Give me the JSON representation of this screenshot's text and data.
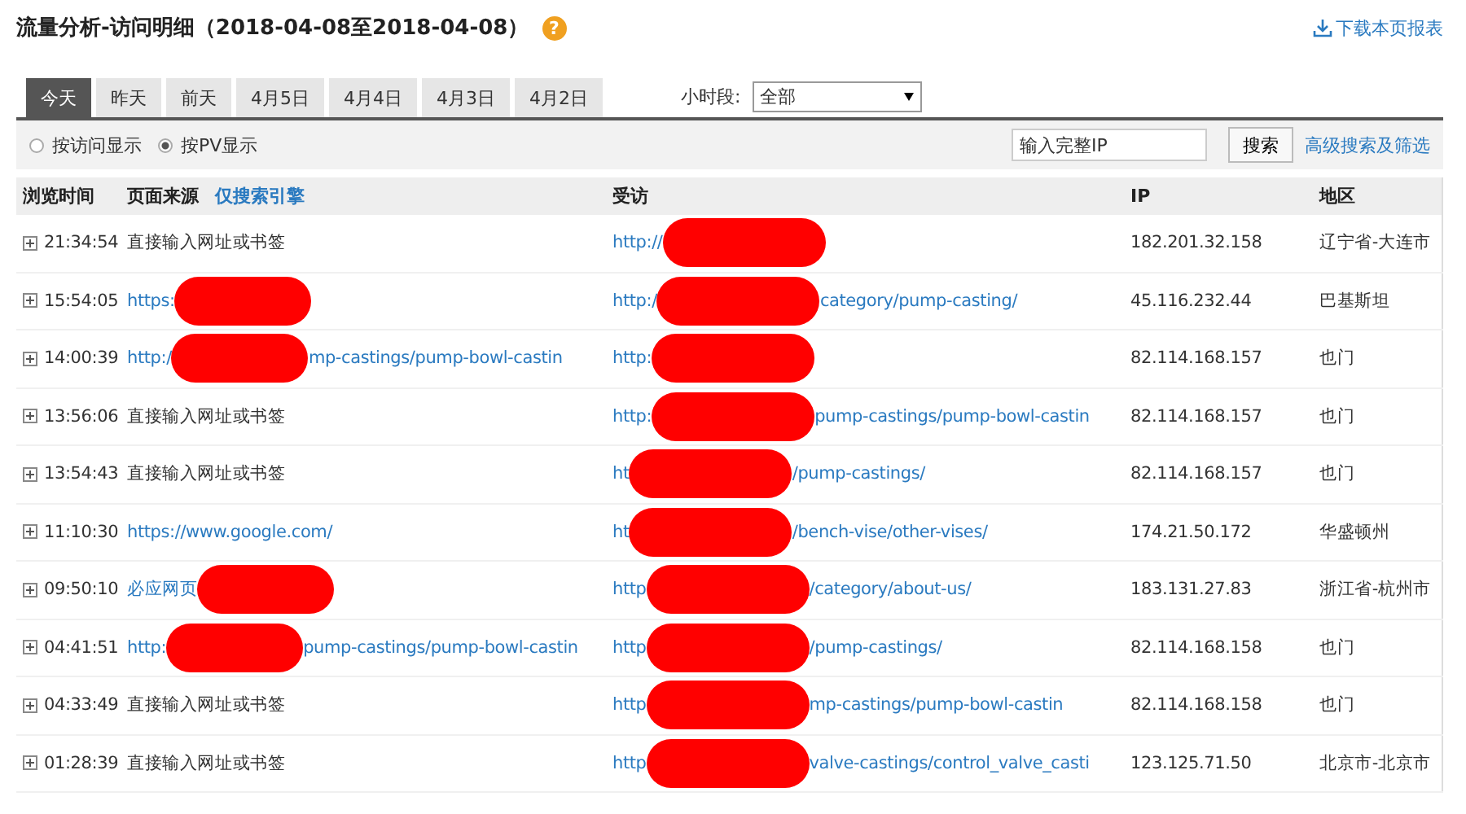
{
  "title": "流量分析-访问明细（2018-04-08至2018-04-08）",
  "help_icon": "?",
  "download_link": "下载本页报表",
  "tabs": [
    {
      "label": "今天",
      "selected": true
    },
    {
      "label": "昨天",
      "selected": false
    },
    {
      "label": "前天",
      "selected": false
    },
    {
      "label": "4月5日",
      "selected": false
    },
    {
      "label": "4月4日",
      "selected": false
    },
    {
      "label": "4月3日",
      "selected": false
    },
    {
      "label": "4月2日",
      "selected": false
    }
  ],
  "time_filter": {
    "label": "小时段:",
    "value": "全部"
  },
  "display_modes": [
    {
      "label": "按访问显示",
      "selected": false
    },
    {
      "label": "按PV显示",
      "selected": true
    }
  ],
  "ip_search": {
    "placeholder": "输入完整IP",
    "button": "搜索",
    "advanced_link": "高级搜索及筛选"
  },
  "table": {
    "columns": [
      "浏览时间",
      "页面来源",
      "受访",
      "IP",
      "地区"
    ],
    "source_filter_link": "仅搜索引擎",
    "rows": [
      {
        "time": "21:34:54",
        "source": {
          "kind": "text",
          "head": "直接输入网址或书签",
          "redacted": false
        },
        "visited": {
          "head": "http://",
          "redacted": true
        },
        "ip": "182.201.32.158",
        "region": "辽宁省-大连市"
      },
      {
        "time": "15:54:05",
        "source": {
          "kind": "link",
          "head": "https:",
          "redacted": true
        },
        "visited": {
          "head": "http:/",
          "redacted": true,
          "tail": "category/pump-casting/"
        },
        "ip": "45.116.232.44",
        "region": "巴基斯坦"
      },
      {
        "time": "14:00:39",
        "source": {
          "kind": "link",
          "head": "http:/",
          "redacted": true,
          "tail": "mp-castings/pump-bowl-castin"
        },
        "visited": {
          "head": "http:",
          "redacted": true
        },
        "ip": "82.114.168.157",
        "region": "也门"
      },
      {
        "time": "13:56:06",
        "source": {
          "kind": "text",
          "head": "直接输入网址或书签",
          "redacted": false
        },
        "visited": {
          "head": "http:",
          "redacted": true,
          "tail": "pump-castings/pump-bowl-castin"
        },
        "ip": "82.114.168.157",
        "region": "也门"
      },
      {
        "time": "13:54:43",
        "source": {
          "kind": "text",
          "head": "直接输入网址或书签",
          "redacted": false
        },
        "visited": {
          "head": "ht",
          "redacted": true,
          "tail": "/pump-castings/"
        },
        "ip": "82.114.168.157",
        "region": "也门"
      },
      {
        "time": "11:10:30",
        "source": {
          "kind": "link",
          "head": "https://www.google.com/",
          "redacted": false
        },
        "visited": {
          "head": "ht",
          "redacted": true,
          "tail": "/bench-vise/other-vises/"
        },
        "ip": "174.21.50.172",
        "region": "华盛顿州"
      },
      {
        "time": "09:50:10",
        "source": {
          "kind": "link",
          "head": "必应网页",
          "redacted": true
        },
        "visited": {
          "head": "http",
          "redacted": true,
          "tail": "/category/about-us/"
        },
        "ip": "183.131.27.83",
        "region": "浙江省-杭州市"
      },
      {
        "time": "04:41:51",
        "source": {
          "kind": "link",
          "head": "http:",
          "redacted": true,
          "tail": "pump-castings/pump-bowl-castin"
        },
        "visited": {
          "head": "http",
          "redacted": true,
          "tail": "/pump-castings/"
        },
        "ip": "82.114.168.158",
        "region": "也门"
      },
      {
        "time": "04:33:49",
        "source": {
          "kind": "text",
          "head": "直接输入网址或书签",
          "redacted": false
        },
        "visited": {
          "head": "http",
          "redacted": true,
          "tail": "mp-castings/pump-bowl-castin"
        },
        "ip": "82.114.168.158",
        "region": "也门"
      },
      {
        "time": "01:28:39",
        "source": {
          "kind": "text",
          "head": "直接输入网址或书签",
          "redacted": false
        },
        "visited": {
          "head": "http",
          "redacted": true,
          "tail": "valve-castings/control_valve_casti"
        },
        "ip": "123.125.71.50",
        "region": "北京市-北京市"
      }
    ]
  }
}
